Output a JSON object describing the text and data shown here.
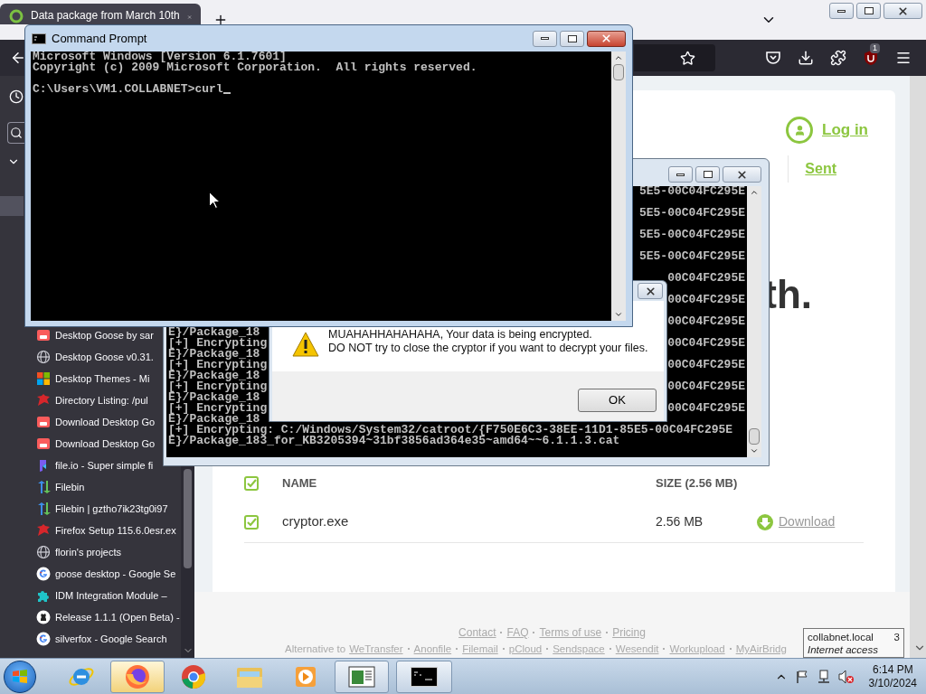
{
  "browser": {
    "tab": {
      "title": "Data package from March 10th",
      "selected": true
    },
    "extension_badge": "1"
  },
  "history_sidebar": {
    "items": [
      {
        "kind": "itch",
        "title": "Desktop Goose by sar"
      },
      {
        "kind": "globe",
        "title": "Desktop Goose v0.31."
      },
      {
        "kind": "windows",
        "title": "Desktop Themes - Mi"
      },
      {
        "kind": "dragon",
        "title": "Directory Listing: /pul"
      },
      {
        "kind": "itch",
        "title": "Download Desktop Go"
      },
      {
        "kind": "itch",
        "title": "Download Desktop Go"
      },
      {
        "kind": "fileio",
        "title": "file.io - Super simple fi"
      },
      {
        "kind": "arrows",
        "title": "Filebin"
      },
      {
        "kind": "arrows",
        "title": "Filebin | gztho7ik23tg0i97"
      },
      {
        "kind": "dragon",
        "title": "Firefox Setup 115.6.0esr.ex"
      },
      {
        "kind": "globe",
        "title": "florin's projects"
      },
      {
        "kind": "google",
        "title": "goose desktop - Google Se"
      },
      {
        "kind": "puzzle",
        "title": "IDM Integration Module –"
      },
      {
        "kind": "github",
        "title": "Release 1.1.1 (Open Beta) -"
      },
      {
        "kind": "google",
        "title": "silverfox - Google Search"
      }
    ]
  },
  "page": {
    "login": "Log in",
    "sent": "Sent",
    "heading_fragment": "th.",
    "table": {
      "columns": [
        "NAME",
        "SIZE (2.56 MB)"
      ],
      "header_checked": true,
      "rows": [
        {
          "name": "cryptor.exe",
          "size": "2.56 MB",
          "checked": true,
          "action": "Download"
        }
      ]
    },
    "footer_links": [
      "Contact",
      "FAQ",
      "Terms of use",
      "Pricing"
    ],
    "alternatives_label": "Alternative to",
    "alternatives": [
      "WeTransfer",
      "Anonfile",
      "Filemail",
      "pCloud",
      "Sendspace",
      "Wesendit",
      "Workupload",
      "MyAirBridg"
    ]
  },
  "background_console": {
    "wrapped_tails": [
      "5E5-00C04FC295E",
      "5E5-00C04FC295E",
      "5E5-00C04FC295E",
      "5E5-00C04FC295E",
      "00C04FC295E",
      "00C04FC295E"
    ],
    "lines": [
      {
        "tail": "00C04FC295E"
      },
      {
        "head": "E}/Package_18"
      },
      {
        "head": "[+] Encrypting",
        "tail": "00C04FC295E"
      },
      {
        "head": "E}/Package_18"
      },
      {
        "head": "[+] Encrypting",
        "tail": "00C04FC295E"
      },
      {
        "head": "E}/Package_18"
      },
      {
        "head": "[+] Encrypting",
        "tail": "00C04FC295E"
      },
      {
        "head": "E}/Package_18"
      },
      {
        "head": "[+] Encrypting",
        "tail": "00C04FC295E"
      },
      {
        "head": "E}/Package_18"
      },
      {
        "text": "[+] Encrypting: C:/Windows/System32/catroot/{F750E6C3-38EE-11D1-85E5-00C04FC295E"
      },
      {
        "text": "E}/Package_183_for_KB3205394~31bf3856ad364e35~amd64~~6.1.1.3.cat"
      }
    ]
  },
  "message_box": {
    "lines": [
      "MUAHAHHAHAHAHA, Your data is being encrypted.",
      "DO NOT try to close the cryptor if you want to decrypt your files."
    ],
    "button": "OK"
  },
  "command_prompt": {
    "title": "Command Prompt",
    "lines": [
      "Microsoft Windows [Version 6.1.7601]",
      "Copyright (c) 2009 Microsoft Corporation.  All rights reserved."
    ],
    "prompt": "C:\\Users\\VM1.COLLABNET>curl",
    "cursor": true
  },
  "tooltip": {
    "title": "collabnet.local",
    "count": "3",
    "status": "Internet access"
  },
  "taskbar": {
    "apps": [
      {
        "kind": "ie",
        "open": false,
        "selected": false
      },
      {
        "kind": "firefox",
        "open": true,
        "selected": true
      },
      {
        "kind": "chrome",
        "open": false,
        "selected": false
      },
      {
        "kind": "explorer",
        "open": false,
        "selected": false
      },
      {
        "kind": "media",
        "open": false,
        "selected": false
      },
      {
        "kind": "window",
        "open": true,
        "selected": false
      },
      {
        "kind": "console",
        "open": true,
        "selected": false
      }
    ],
    "volume_muted": true,
    "time": "6:14 PM",
    "date": "3/10/2024"
  }
}
